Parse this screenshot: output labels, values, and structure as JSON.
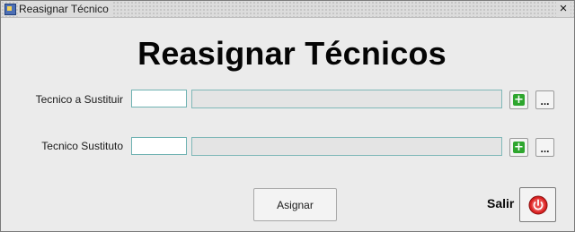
{
  "window": {
    "title": "Reasignar Técnico",
    "close_glyph": "×"
  },
  "heading": "Reasignar Técnicos",
  "rows": [
    {
      "label": "Tecnico a Sustituir",
      "code_value": "",
      "name_value": "",
      "add_glyph": "+",
      "lov_glyph": "..."
    },
    {
      "label": "Tecnico Sustituto",
      "code_value": "",
      "name_value": "",
      "add_glyph": "+",
      "lov_glyph": "..."
    }
  ],
  "actions": {
    "assign_label": "Asignar",
    "exit_label": "Salir"
  },
  "icons": {
    "window": "form-window-icon",
    "add": "green-plus-icon",
    "lov": "ellipsis-icon",
    "exit": "power-icon"
  },
  "colors": {
    "add_icon": "#2ea62e",
    "exit_icon": "#d92222",
    "field_border": "#80b8b8"
  }
}
